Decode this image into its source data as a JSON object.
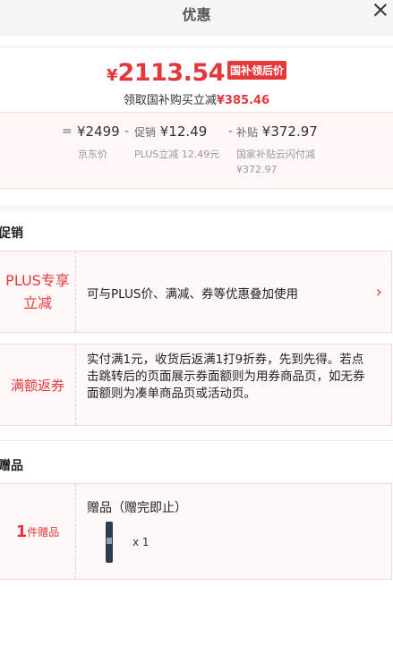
{
  "header": {
    "title": "优惠"
  },
  "price": {
    "currency": "¥",
    "final": "2113.54",
    "tag": "国补领后价",
    "subsidy_text": "领取国补购买立减",
    "subsidy_amount": "¥385.46"
  },
  "breakdown": {
    "equals": "=",
    "jd_price": "¥2499",
    "jd_label": "京东价",
    "minus1": "-",
    "promo_small": "促销",
    "promo_value": "¥12.49",
    "promo_label": "PLUS立减 12.49元",
    "minus2": "-",
    "subsidy_small": "补贴",
    "subsidy_value": "¥372.97",
    "subsidy_label_line1": "国家补贴云闪付减",
    "subsidy_label_line2": "¥372.97"
  },
  "promotions": {
    "title": "促销",
    "items": [
      {
        "tag_line1": "PLUS专享",
        "tag_line2": "立减",
        "text": "可与PLUS价、满减、券等优惠叠加使用",
        "arrow": "›"
      },
      {
        "tag_line1": "满额返券",
        "text": "实付满1元，收货后返满1打9折券，先到先得。若点击跳转后的页面展示券面额则为用券商品页，如无券面额则为凑单商品页或活动页。"
      }
    ]
  },
  "gifts": {
    "title": "赠品",
    "count": "1",
    "count_suffix": "件赠品",
    "heading": "赠品（赠完即止）",
    "qty": "x 1"
  },
  "colors": {
    "accent": "#e4393c",
    "card_bg": "#fff8f8"
  }
}
